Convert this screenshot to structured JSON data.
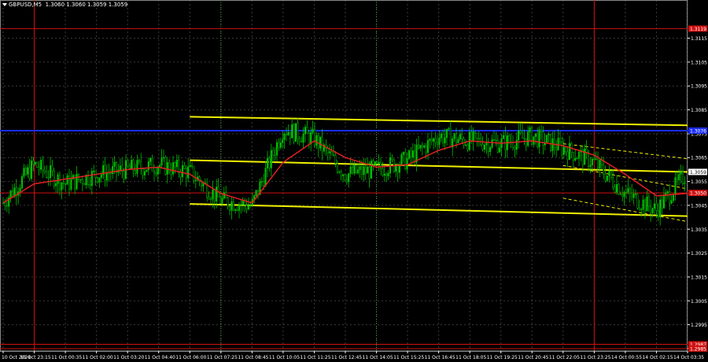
{
  "header": {
    "symbol": "GBPUSD,M5",
    "ohlc": "1.3060 1.3060 1.3059 1.3059"
  },
  "colors": {
    "background": "#000000",
    "grid": "#3a3a3a",
    "up": "#00c000",
    "down": "#00c000",
    "ma": "#e02020",
    "yellow": "#f0f000",
    "blue": "#1a2cff",
    "red_level": "#d01010",
    "price_label_bg": "#d01010",
    "current_label_bg": "#ffffff",
    "axis_text": "#ffffff",
    "vline_red": "#d01010",
    "vline_green": "#3aa03a",
    "frame": "#ffffff"
  },
  "chart_data": {
    "type": "candlestick",
    "instrument": "GBPUSD",
    "timeframe": "M5",
    "ylim": [
      1.2984,
      1.3131
    ],
    "y_ticks": [
      "1.3115",
      "1.3105",
      "1.3095",
      "1.3085",
      "1.3075",
      "1.3065",
      "1.3055",
      "1.3045",
      "1.3035",
      "1.3025",
      "1.3015",
      "1.3005",
      "1.2995",
      "1.2985"
    ],
    "x_ticks": [
      "10 Oct 2024",
      "10 Oct 23:15",
      "11 Oct 00:35",
      "11 Oct 02:00",
      "11 Oct 03:20",
      "11 Oct 04:40",
      "11 Oct 06:00",
      "11 Oct 07:25",
      "11 Oct 08:45",
      "11 Oct 10:05",
      "11 Oct 11:25",
      "11 Oct 12:45",
      "11 Oct 14:05",
      "11 Oct 15:25",
      "11 Oct 16:45",
      "11 Oct 18:05",
      "11 Oct 19:25",
      "11 Oct 20:45",
      "11 Oct 22:05",
      "11 Oct 23:25",
      "14 Oct 00:55",
      "14 Oct 02:15",
      "14 Oct 03:35"
    ],
    "price_levels": [
      {
        "label": "1.3119",
        "value": 1.3119,
        "color": "red"
      },
      {
        "label": "1.3076",
        "value": 1.30763,
        "color": "blue"
      },
      {
        "label": "1.3050",
        "value": 1.30502,
        "color": "red"
      },
      {
        "label": "1.2987",
        "value": 1.29868,
        "color": "red"
      },
      {
        "label": "1.2985",
        "value": 1.2985,
        "color": "red"
      }
    ],
    "current_price": {
      "label": "1.3059",
      "value": 1.3059
    },
    "vertical_lines": [
      {
        "x_label": "10 Oct 23:15",
        "style": "red-solid"
      },
      {
        "x_label": "11 Oct 07:25",
        "style": "green-dotted"
      },
      {
        "x_label": "11 Oct 14:05",
        "style": "green-dotted"
      },
      {
        "x_label": "11 Oct 23:25",
        "style": "red-solid"
      }
    ],
    "channel_lines": [
      {
        "name": "upper",
        "start": [
          "11 Oct 06:00",
          1.30821
        ],
        "end": [
          "14 Oct 03:35",
          1.30785
        ]
      },
      {
        "name": "middle",
        "start": [
          "11 Oct 06:00",
          1.30639
        ],
        "end": [
          "14 Oct 03:35",
          1.3059
        ]
      },
      {
        "name": "lower",
        "start": [
          "11 Oct 06:00",
          1.30456
        ],
        "end": [
          "14 Oct 03:35",
          1.30405
        ]
      }
    ],
    "trend_channel": [
      {
        "start": [
          "11 Oct 22:05",
          1.30708
        ],
        "end": [
          "14 Oct 03:35",
          1.30645
        ]
      },
      {
        "start": [
          "11 Oct 22:05",
          1.30617
        ],
        "end": [
          "14 Oct 03:35",
          1.30519
        ]
      },
      {
        "start": [
          "11 Oct 22:05",
          1.3048
        ],
        "end": [
          "14 Oct 03:35",
          1.30382
        ]
      }
    ],
    "price_path": [
      [
        "10 Oct 2024",
        1.3046
      ],
      [
        "10 Oct 23:15",
        1.3062
      ],
      [
        "11 Oct 00:35",
        1.3054
      ],
      [
        "11 Oct 02:00",
        1.3058
      ],
      [
        "11 Oct 03:20",
        1.306
      ],
      [
        "11 Oct 04:40",
        1.3062
      ],
      [
        "11 Oct 06:00",
        1.3059
      ],
      [
        "11 Oct 07:25",
        1.3047
      ],
      [
        "11 Oct 08:45",
        1.3045
      ],
      [
        "11 Oct 10:05",
        1.3077
      ],
      [
        "11 Oct 11:25",
        1.3073
      ],
      [
        "11 Oct 12:45",
        1.3058
      ],
      [
        "11 Oct 14:05",
        1.306
      ],
      [
        "11 Oct 15:25",
        1.3064
      ],
      [
        "11 Oct 16:45",
        1.3074
      ],
      [
        "11 Oct 18:05",
        1.3072
      ],
      [
        "11 Oct 19:25",
        1.3071
      ],
      [
        "11 Oct 20:45",
        1.3074
      ],
      [
        "11 Oct 22:05",
        1.3069
      ],
      [
        "11 Oct 23:25",
        1.3063
      ],
      [
        "14 Oct 00:55",
        1.305
      ],
      [
        "14 Oct 02:15",
        1.3043
      ],
      [
        "14 Oct 03:35",
        1.3059
      ]
    ],
    "ma_path": [
      [
        "10 Oct 2024",
        1.3046
      ],
      [
        "10 Oct 23:15",
        1.3054
      ],
      [
        "11 Oct 00:35",
        1.3056
      ],
      [
        "11 Oct 02:00",
        1.3058
      ],
      [
        "11 Oct 03:20",
        1.306
      ],
      [
        "11 Oct 04:40",
        1.3061
      ],
      [
        "11 Oct 06:00",
        1.3058
      ],
      [
        "11 Oct 07:25",
        1.305
      ],
      [
        "11 Oct 08:45",
        1.3046
      ],
      [
        "11 Oct 10:05",
        1.3063
      ],
      [
        "11 Oct 11:25",
        1.3072
      ],
      [
        "11 Oct 12:45",
        1.3065
      ],
      [
        "11 Oct 14:05",
        1.3061
      ],
      [
        "11 Oct 15:25",
        1.3062
      ],
      [
        "11 Oct 16:45",
        1.3068
      ],
      [
        "11 Oct 18:05",
        1.3072
      ],
      [
        "11 Oct 19:25",
        1.3071
      ],
      [
        "11 Oct 20:45",
        1.3072
      ],
      [
        "11 Oct 22:05",
        1.307
      ],
      [
        "11 Oct 23:25",
        1.3066
      ],
      [
        "14 Oct 00:55",
        1.3058
      ],
      [
        "14 Oct 02:15",
        1.3049
      ],
      [
        "14 Oct 03:35",
        1.305
      ]
    ]
  }
}
